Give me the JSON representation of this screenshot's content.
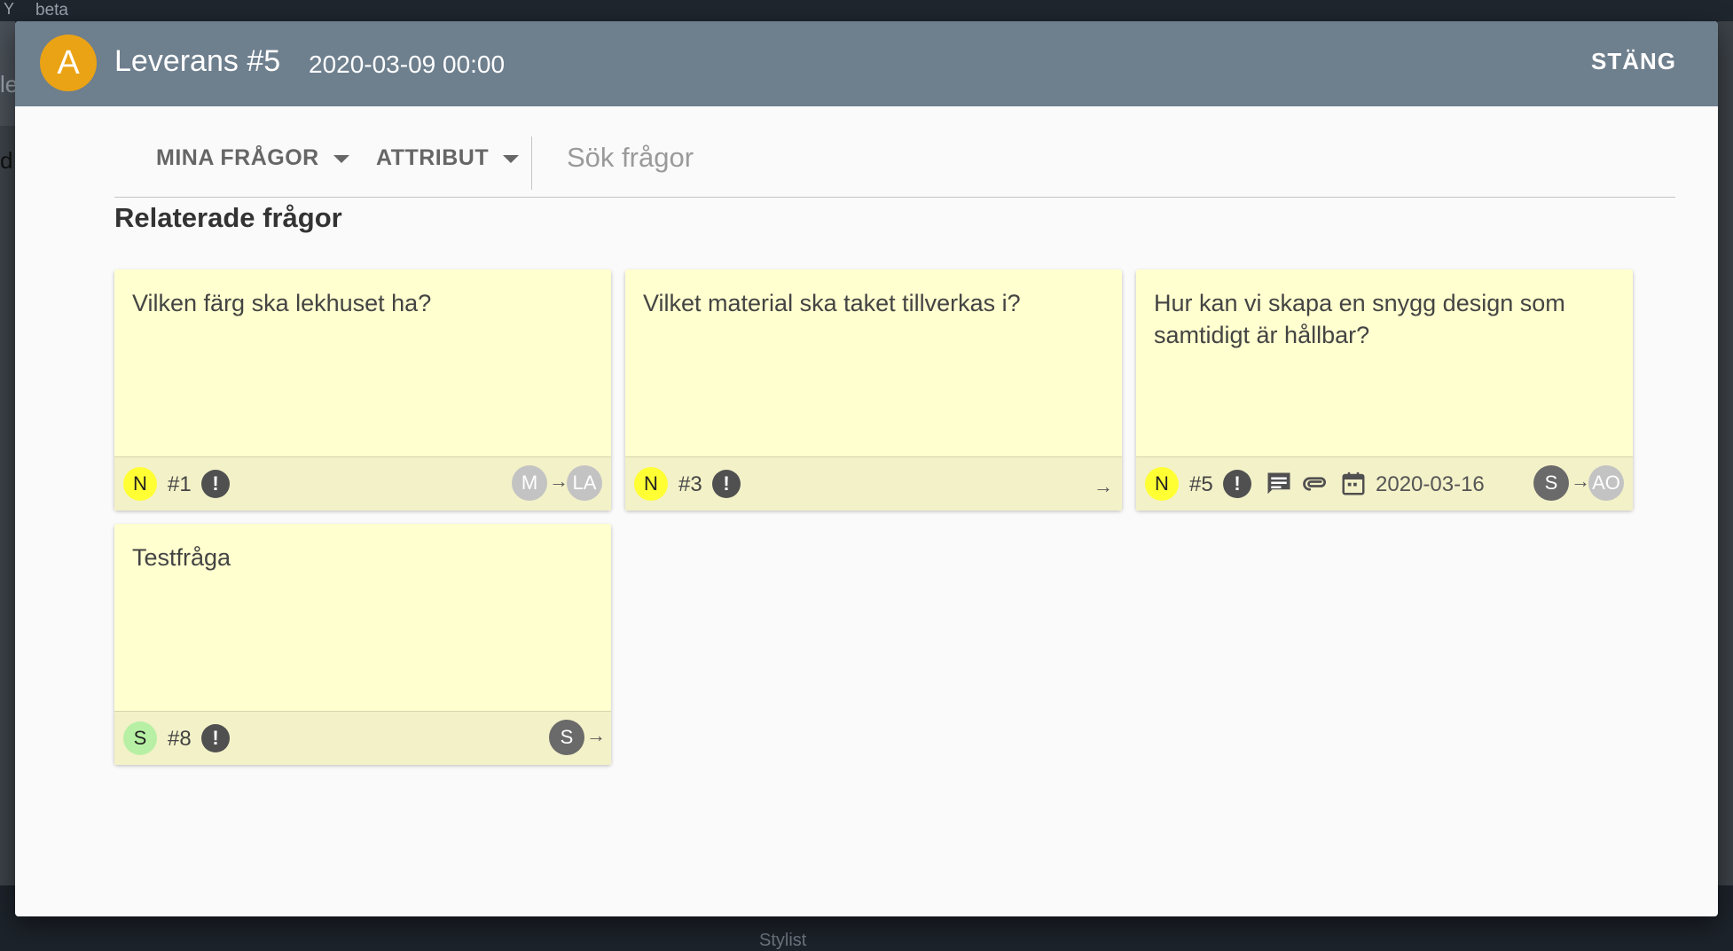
{
  "background": {
    "beta": "beta",
    "bottom_label": "Stylist",
    "frag1": "le",
    "frag2": "d"
  },
  "dialog": {
    "avatar_letter": "A",
    "title": "Leverans #5",
    "date": "2020-03-09 00:00",
    "close_label": "STÄNG"
  },
  "toolbar": {
    "my_questions_label": "MINA FRÅGOR",
    "attributes_label": "ATTRIBUT",
    "search_placeholder": "Sök frågor"
  },
  "section_title": "Relaterade frågor",
  "colors": {
    "header": "#6e7f8e",
    "avatar": "#eaa314",
    "card": "#ffffcf",
    "status_new": "#ffff33",
    "status_s": "#b7f0a5"
  },
  "cards": [
    {
      "text": "Vilken färg ska lekhuset ha?",
      "status": "N",
      "number": "#1",
      "from": "M",
      "to": "LA"
    },
    {
      "text": "Vilket material ska taket tillverkas i?",
      "status": "N",
      "number": "#3"
    },
    {
      "text": "Hur kan vi skapa en snygg design som samtidigt är hållbar?",
      "status": "N",
      "number": "#5",
      "due_date": "2020-03-16",
      "from": "S",
      "to": "AO",
      "icons": [
        "comment-icon",
        "attachment-icon",
        "calendar-icon"
      ]
    },
    {
      "text": "Testfråga",
      "status": "S",
      "number": "#8",
      "from": "S"
    }
  ]
}
